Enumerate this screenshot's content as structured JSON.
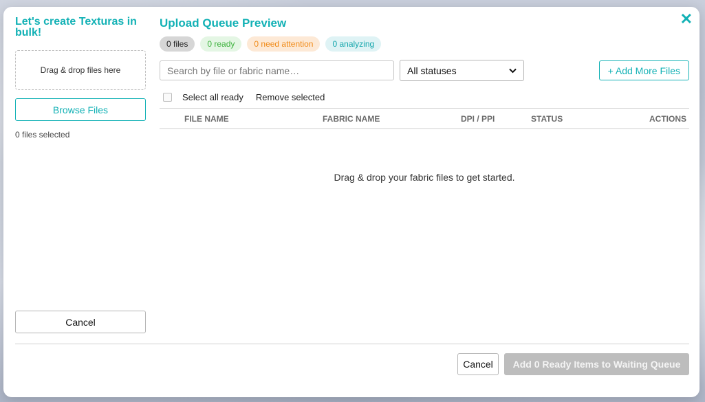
{
  "left": {
    "title": "Let's create Texturas in bulk!",
    "dropzone_text": "Drag & drop files here",
    "browse_label": "Browse Files",
    "files_selected": "0 files selected",
    "cancel_label": "Cancel"
  },
  "main": {
    "title": "Upload Queue Preview",
    "badges": {
      "files": "0 files",
      "ready": "0 ready",
      "attention": "0 need attention",
      "analyzing": "0 analyzing"
    },
    "search_placeholder": "Search by file or fabric name…",
    "status_filter": "All statuses",
    "add_more_label": "+ Add More Files",
    "select_all_ready": "Select all ready",
    "remove_selected": "Remove selected",
    "columns": [
      "FILE NAME",
      "FABRIC NAME",
      "DPI / PPI",
      "STATUS",
      "ACTIONS"
    ],
    "empty_message": "Drag & drop your fabric files to get started."
  },
  "footer": {
    "cancel_label": "Cancel",
    "primary_label": "Add 0 Ready Items to Waiting Queue"
  },
  "colors": {
    "accent": "#12b1b5",
    "ready": "#3db23d",
    "attention": "#f08a17",
    "disabled": "#bdbdbd"
  },
  "icons": {
    "close": "close-icon",
    "dropdown": "chevron-down-icon"
  }
}
